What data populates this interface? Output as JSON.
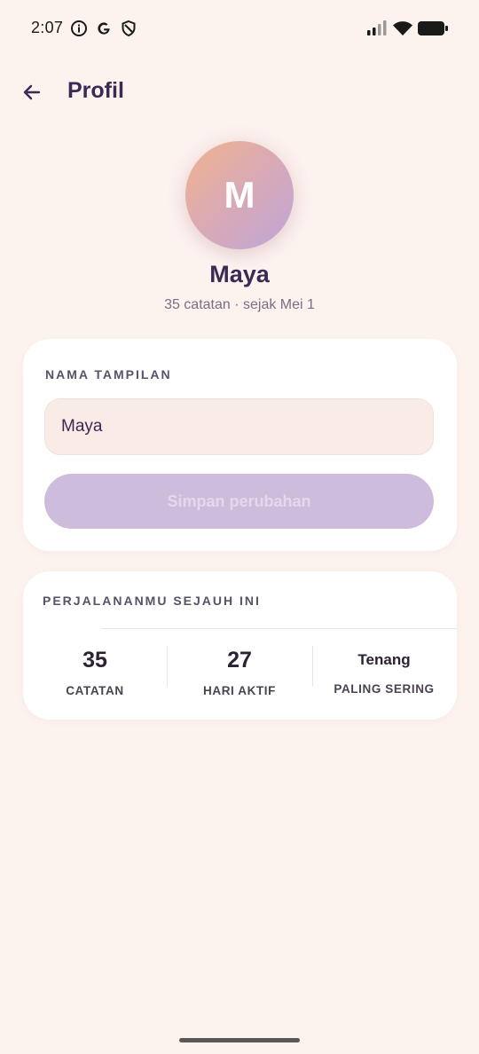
{
  "status_bar": {
    "time": "2:07",
    "left_icons": [
      "info-icon",
      "google-icon",
      "shield-icon"
    ],
    "right_icons": [
      "signal-icon",
      "wifi-icon",
      "battery-icon"
    ]
  },
  "app_bar": {
    "back_icon": "arrow-left-icon",
    "title": "Profil"
  },
  "profile": {
    "avatar_letter": "M",
    "name": "Maya",
    "meta": "35 catatan · sejak Mei 1"
  },
  "display_name_card": {
    "label": "NAMA TAMPILAN",
    "input_value": "Maya",
    "save_label": "Simpan perubahan",
    "save_enabled": false
  },
  "journey_card": {
    "label": "PERJALANANMU SEJAUH INI",
    "stats": [
      {
        "value": "35",
        "label": "CATATAN"
      },
      {
        "value": "27",
        "label": "HARI AKTIF"
      },
      {
        "value": "Tenang",
        "label": "PALING SERING"
      }
    ]
  },
  "colors": {
    "background": "#fcf3ef",
    "title": "#3a2a54",
    "avatar_gradient": [
      "#f0b48e",
      "#bfa6d8"
    ],
    "button_disabled": "#cdbcdc",
    "input_bg": "#f9ebe6"
  }
}
